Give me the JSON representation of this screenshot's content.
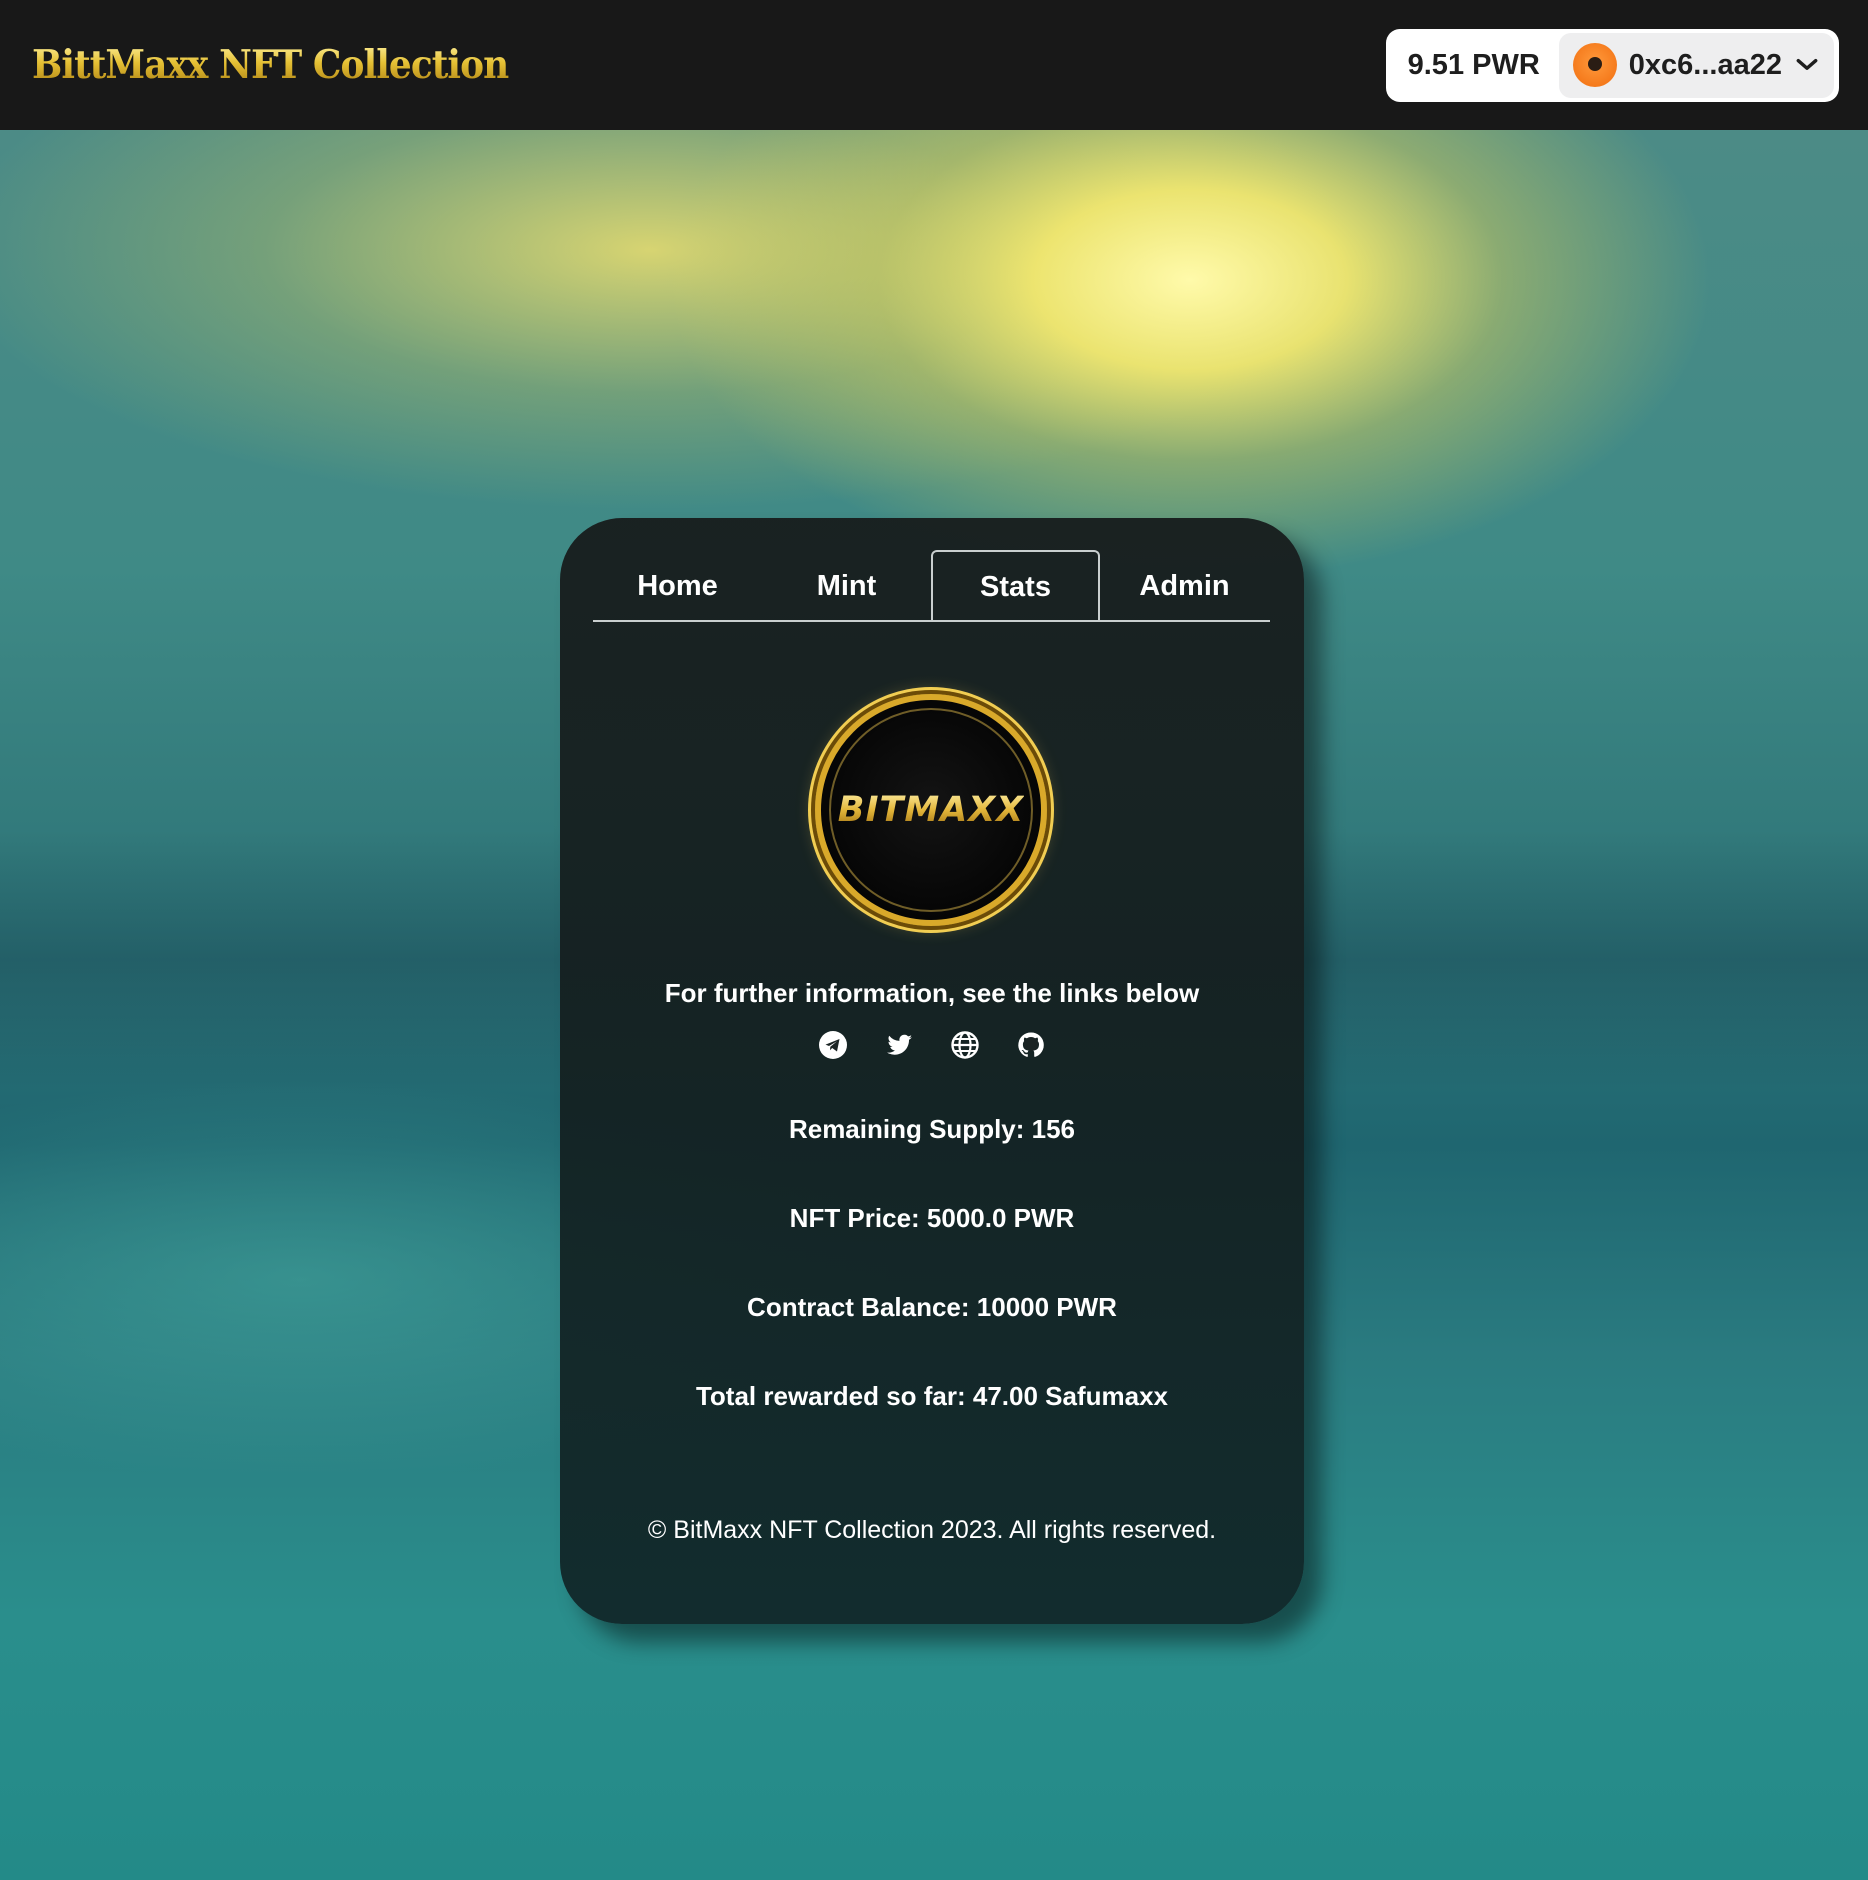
{
  "header": {
    "logo_text": "BittMaxx NFT Collection",
    "wallet": {
      "balance": "9.51 PWR",
      "address": "0xc6...aa22",
      "avatar_color": "#f57a1c"
    }
  },
  "card": {
    "tabs": [
      {
        "label": "Home",
        "active": false
      },
      {
        "label": "Mint",
        "active": false
      },
      {
        "label": "Stats",
        "active": true
      },
      {
        "label": "Admin",
        "active": false
      }
    ],
    "token_logo_text": "BITMAXX",
    "info_text": "For further information, see the links below",
    "social_icons": [
      "telegram-icon",
      "twitter-icon",
      "globe-icon",
      "github-icon"
    ],
    "stats": {
      "remaining_supply": "Remaining Supply: 156",
      "nft_price": "NFT Price: 5000.0 PWR",
      "contract_balance": "Contract Balance: 10000 PWR",
      "total_rewarded": "Total rewarded so far: 47.00 Safumaxx"
    },
    "footer": "© BitMaxx NFT Collection 2023. All rights reserved."
  },
  "colors": {
    "accent_gold": "#e5c034",
    "header_bg": "#181818",
    "card_bg": "#182020"
  }
}
